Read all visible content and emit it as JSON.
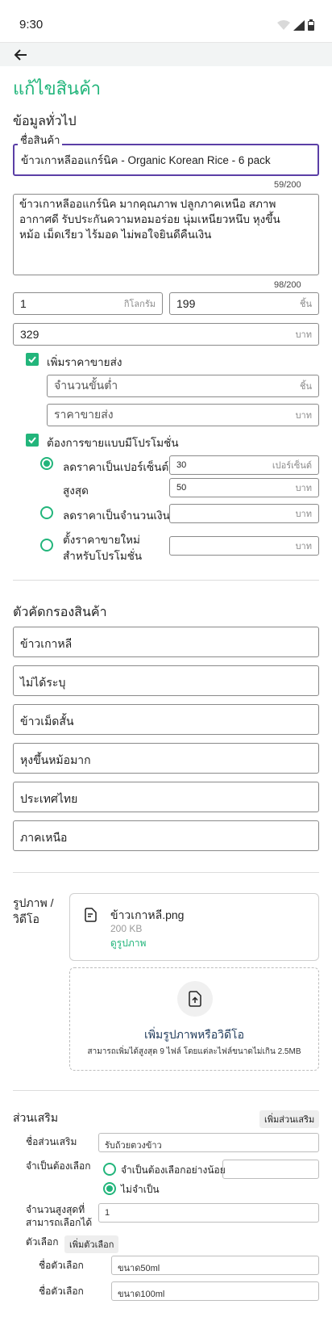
{
  "status": {
    "time": "9:30"
  },
  "page": {
    "title": "แก้ไขสินค้า"
  },
  "general": {
    "section_title": "ข้อมูลทั่วไป",
    "name_label": "ชื่อสินค้า",
    "name_value": "ข้าวเกาหลีออแกร์นิค - Organic Korean Rice - 6 pack",
    "name_counter": "59/200",
    "description": "ข้าวเกาหลีออแกร์นิค มากคุณภาพ ปลูกภาคเหนือ สภาพอากาศดี รับประกันความหอมอร่อย นุ่มเหนียวหนึบ หุงขึ้นหม้อ เม็ดเรียว ไร้มอด ไม่พอใจยินดีคืนเงิน",
    "description_counter": "98/200",
    "weight_value": "1",
    "weight_unit": "กิโลกรัม",
    "stock_value": "199",
    "stock_unit": "ชิ้น",
    "price_value": "329",
    "price_unit": "บาท",
    "wholesale_checkbox_label": "เพิ่มราคาขายส่ง",
    "min_qty_placeholder": "จำนวนขั้นต่ำ",
    "min_qty_unit": "ชิ้น",
    "wholesale_price_placeholder": "ราคาขายส่ง",
    "wholesale_price_unit": "บาท",
    "promo_checkbox_label": "ต้องการขายแบบมีโปรโมชั่น",
    "promo_percent_label": "ลดราคาเป็นเปอร์เซ็นต์",
    "promo_percent_value": "30",
    "promo_percent_unit": "เปอร์เซ็นต์",
    "promo_max_label": "สูงสุด",
    "promo_max_value": "50",
    "promo_max_unit": "บาท",
    "promo_amount_label": "ลดราคาเป็นจำนวนเงิน",
    "promo_amount_unit": "บาท",
    "promo_newprice_label_1": "ตั้งราคาขายใหม่",
    "promo_newprice_label_2": "สำหรับโปรโมชั่น",
    "promo_newprice_unit": "บาท"
  },
  "filters": {
    "section_title": "ตัวคัดกรองสินค้า",
    "items": [
      "ข้าวเกาหลี",
      "ไม่ได้ระบุ",
      "ข้าวเม็ดสั้น",
      "หุงขึ้นหม้อมาก",
      "ประเทศไทย",
      "ภาคเหนือ"
    ]
  },
  "media": {
    "label_1": "รูปภาพ /",
    "label_2": "วิดีโอ",
    "file_name": "ข้าวเกาหลี.png",
    "file_size": "200 KB",
    "view_link": "ดูรูปภาพ",
    "upload_title": "เพิ่มรูปภาพหรือวิดีโอ",
    "upload_hint": "สามารถเพิ่มได้สูงสุด 9 ไฟล์ โดยแต่ละไฟล์ขนาดไม่เกิน 2.5MB"
  },
  "addon": {
    "section_title": "ส่วนเสริม",
    "add_button": "เพิ่มส่วนเสริม",
    "name_label": "ชื่อส่วนเสริม",
    "name_value": "รับถ้วยตวงข้าว",
    "required_label": "จำเป็นต้องเลือก",
    "required_option_1": "จำเป็นต้องเลือกอย่างน้อย",
    "required_option_2": "ไม่จำเป็น",
    "max_label_1": "จำนวนสูงสุดที่",
    "max_label_2": "สามารถเลือกได้",
    "max_value": "1",
    "options_label": "ตัวเลือก",
    "add_option_button": "เพิ่มตัวเลือก",
    "option_name_label": "ชื่อตัวเลือก",
    "options": [
      "ขนาด50ml",
      "ขนาด100ml"
    ]
  },
  "colors": {
    "accent": "#22b57b",
    "focus": "#5b3fa6"
  }
}
